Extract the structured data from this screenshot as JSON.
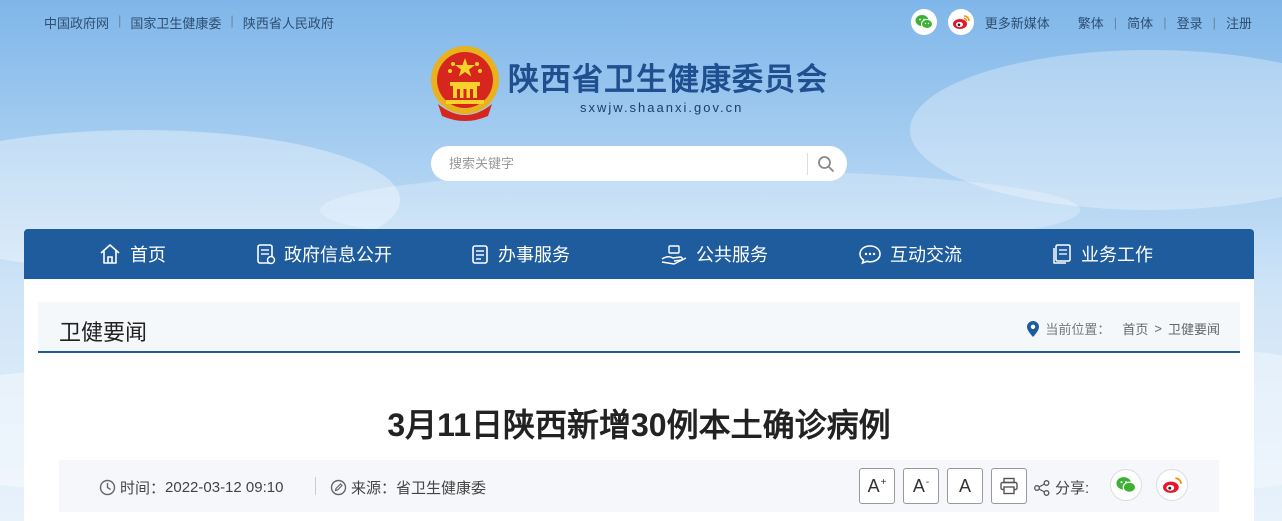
{
  "top_links": [
    "中国政府网",
    "国家卫生健康委",
    "陕西省人民政府"
  ],
  "top_right": {
    "more_media": "更多新媒体",
    "traditional": "繁体",
    "simplified": "简体",
    "login": "登录",
    "register": "注册"
  },
  "site": {
    "title": "陕西省卫生健康委员会",
    "domain": "sxwjw.shaanxi.gov.cn"
  },
  "search": {
    "placeholder": "搜索关键字"
  },
  "nav": {
    "items": [
      {
        "label": "首页",
        "icon": "home-icon"
      },
      {
        "label": "政府信息公开",
        "icon": "document-list-icon"
      },
      {
        "label": "办事服务",
        "icon": "clipboard-icon"
      },
      {
        "label": "公共服务",
        "icon": "hand-service-icon"
      },
      {
        "label": "互动交流",
        "icon": "chat-icon"
      },
      {
        "label": "业务工作",
        "icon": "files-icon"
      }
    ]
  },
  "section": {
    "title": "卫健要闻",
    "breadcrumb_label": "当前位置：",
    "breadcrumb_home": "首页",
    "breadcrumb_arrow": ">",
    "breadcrumb_current": "卫健要闻"
  },
  "article": {
    "title": "3月11日陕西新增30例本土确诊病例",
    "time_label": "时间：",
    "time_value": "2022-03-12 09:10",
    "source_label": "来源：",
    "source_value": "省卫生健康委",
    "font_large": "A",
    "font_small": "A",
    "font_reset": "A",
    "share_label": "分享:"
  },
  "colors": {
    "nav_bg": "#1e5c9e",
    "title_blue": "#1f4f8e",
    "wechat_green": "#3eb135",
    "weibo_red": "#e6162d"
  }
}
